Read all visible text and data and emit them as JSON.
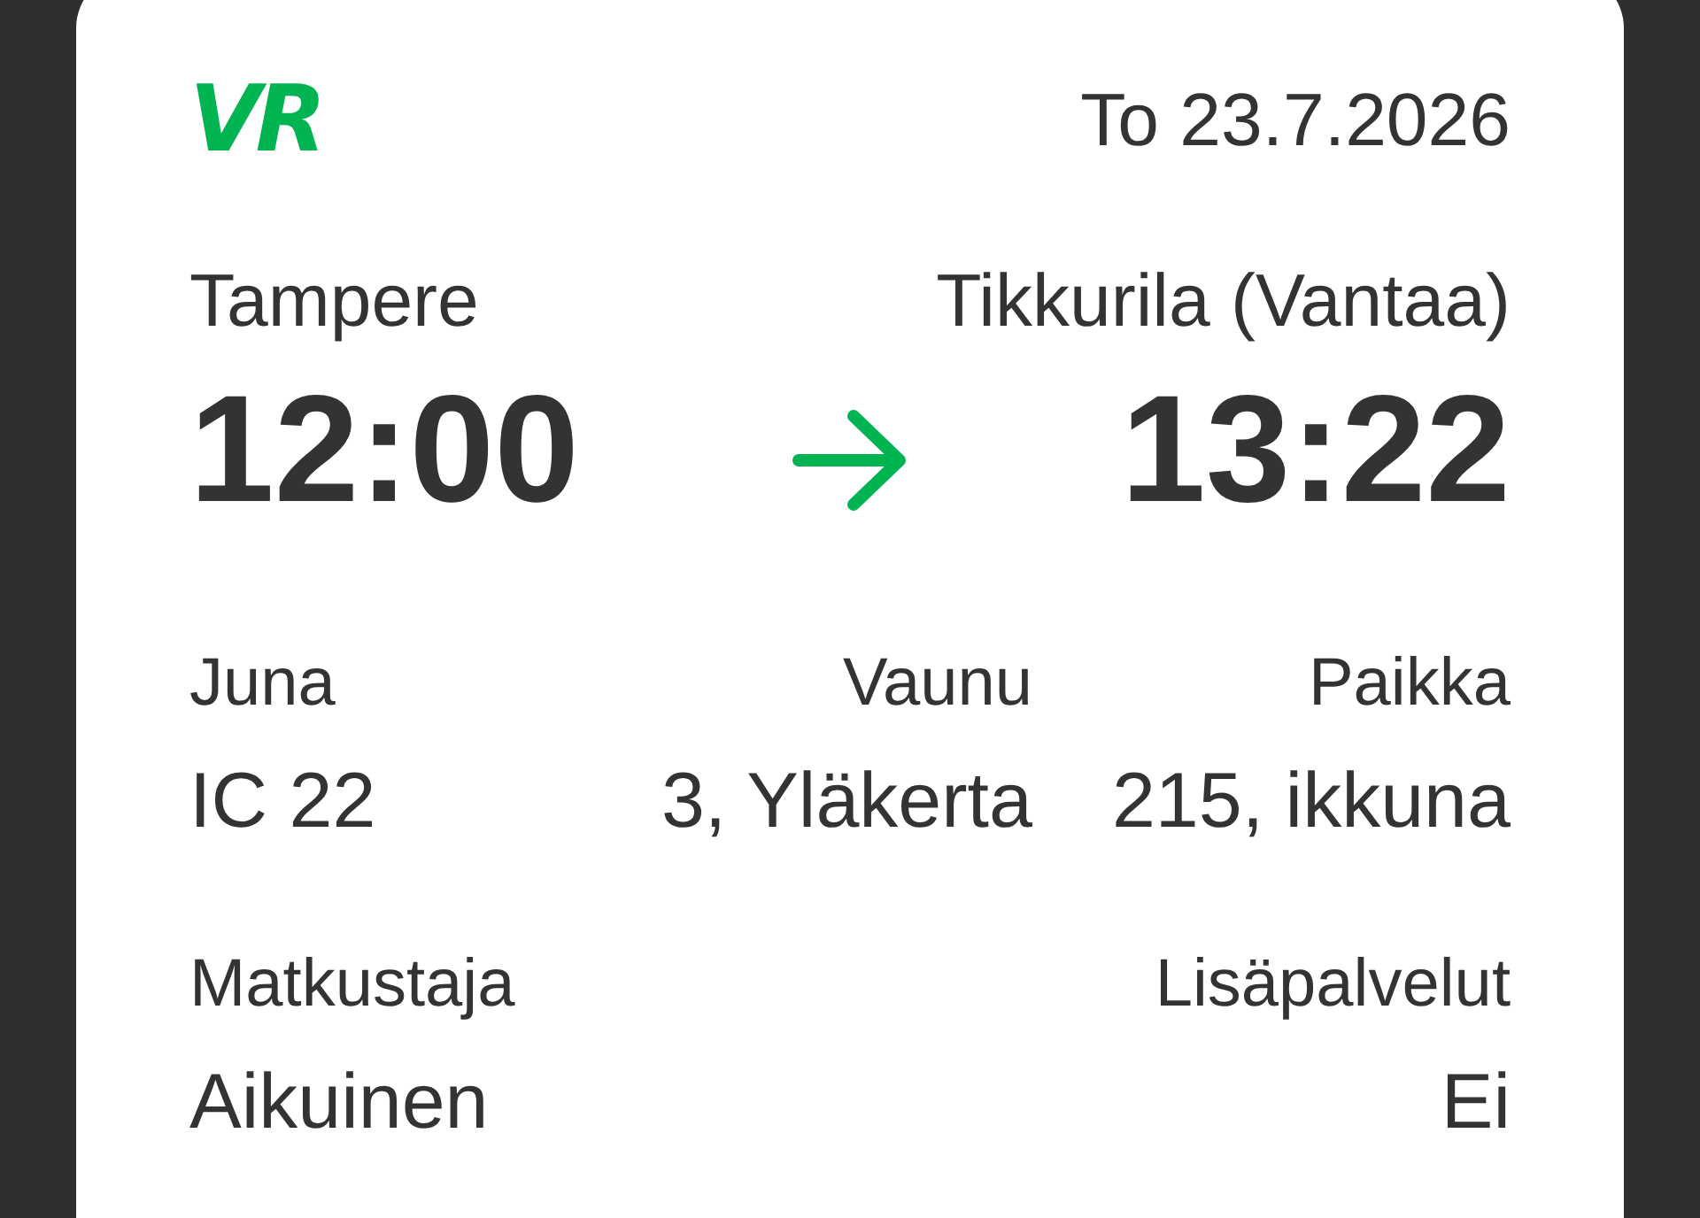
{
  "logo": {
    "text": "VR"
  },
  "date": "To 23.7.2026",
  "journey": {
    "departure": {
      "station": "Tampere",
      "time": "12:00"
    },
    "arrival": {
      "station": "Tikkurila (Vantaa)",
      "time": "13:22"
    }
  },
  "details": [
    {
      "label": "Juna",
      "value": "IC 22"
    },
    {
      "label": "Vaunu",
      "value": "3, Yläkerta"
    },
    {
      "label": "Paikka",
      "value": "215, ikkuna"
    }
  ],
  "passenger_details": [
    {
      "label": "Matkustaja",
      "value": "Aikuinen"
    },
    {
      "label": "Lisäpalvelut",
      "value": "Ei"
    }
  ]
}
